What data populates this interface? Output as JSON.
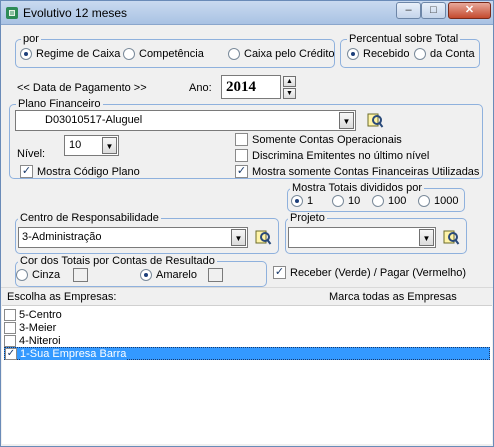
{
  "window": {
    "title": "Evolutivo 12 meses"
  },
  "por": {
    "legend": "por",
    "options": [
      {
        "label": "Regime de Caixa",
        "selected": true
      },
      {
        "label": "Competência",
        "selected": false
      },
      {
        "label": "Caixa pelo Crédito",
        "selected": false
      }
    ]
  },
  "percentual": {
    "legend": "Percentual sobre Total",
    "options": [
      {
        "label": "Recebido",
        "selected": true
      },
      {
        "label": "da Conta",
        "selected": false
      }
    ]
  },
  "data_pagamento": {
    "label": "<< Data de Pagamento >>",
    "ano_label": "Ano:",
    "ano_value": "2014"
  },
  "plano": {
    "legend": "Plano Financeiro",
    "selected": "D03010517-Aluguel",
    "nivel_label": "Nível:",
    "nivel_value": "10",
    "mostra_codigo": {
      "label": "Mostra Código Plano",
      "checked": true
    },
    "somente_operacionais": {
      "label": "Somente Contas Operacionais",
      "checked": false
    },
    "discrimina": {
      "label": "Discrimina Emitentes no último nível",
      "checked": false
    },
    "somente_utilizadas": {
      "label": "Mostra somente Contas Financeiras Utilizadas",
      "checked": true
    }
  },
  "totais": {
    "legend": "Mostra Totais divididos por",
    "options": [
      {
        "label": "1",
        "selected": true
      },
      {
        "label": "10",
        "selected": false
      },
      {
        "label": "100",
        "selected": false
      },
      {
        "label": "1000",
        "selected": false
      }
    ]
  },
  "centro": {
    "legend": "Centro de Responsabilidade",
    "selected": "3-Administração"
  },
  "projeto": {
    "legend": "Projeto",
    "selected": ""
  },
  "cor": {
    "legend": "Cor dos Totais por Contas de Resultado",
    "options": [
      {
        "label": "Cinza",
        "selected": false
      },
      {
        "label": "Amarelo",
        "selected": true
      }
    ]
  },
  "receber": {
    "label": "Receber (Verde) / Pagar (Vermelho)",
    "checked": true
  },
  "empresas": {
    "label": "Escolha as Empresas:",
    "marca_todas": "Marca todas as Empresas",
    "items": [
      {
        "label": "5-Centro",
        "checked": false,
        "selected": false
      },
      {
        "label": "3-Meier",
        "checked": false,
        "selected": false
      },
      {
        "label": "4-Niteroi",
        "checked": false,
        "selected": false
      },
      {
        "label": "1-Sua Empresa Barra",
        "checked": true,
        "selected": true
      }
    ]
  },
  "colors": {
    "group_border": "#8fb1dd",
    "selection": "#3399ff",
    "titlebar": "#b9cfea"
  }
}
